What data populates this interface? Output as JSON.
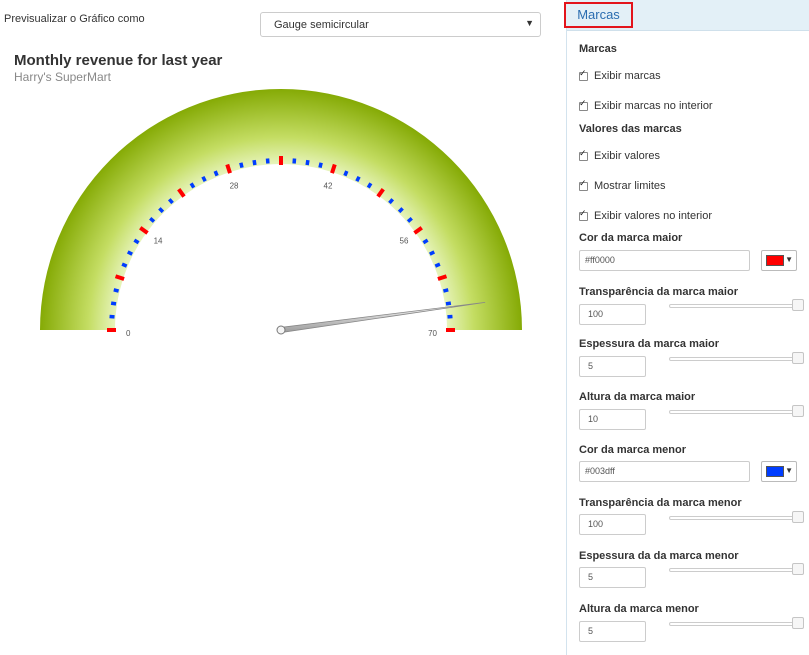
{
  "preview": {
    "label": "Previsualizar o Gráfico como",
    "chart_type": "Gauge semicircular"
  },
  "chart": {
    "title": "Monthly revenue for last year",
    "subtitle": "Harry's SuperMart"
  },
  "chart_data": {
    "type": "gauge",
    "min": 0,
    "max": 70,
    "value": 67,
    "major_tick_labels": [
      "0",
      "14",
      "28",
      "42",
      "56",
      "70"
    ],
    "major_ticks": [
      0,
      7,
      14,
      21,
      28,
      35,
      42,
      49,
      56,
      63,
      70
    ],
    "minor_ticks_between_major": 3,
    "colors": {
      "major_tick": "#ff0000",
      "minor_tick": "#003dff",
      "band_outer": "#88ad06",
      "band_inner": "#eef9cf"
    }
  },
  "panel": {
    "tab_label": "Marcas",
    "section_marcas": "Marcas",
    "show_ticks": "Exibir marcas",
    "show_ticks_inside": "Exibir marcas no interior",
    "section_values": "Valores das marcas",
    "show_values": "Exibir valores",
    "show_limits": "Mostrar limites",
    "show_values_inside": "Exibir valores no interior",
    "major_color_label": "Cor da marca maior",
    "major_color_value": "#ff0000",
    "major_color_swatch": "#ff0000",
    "major_alpha_label": "Transparência da marca maior",
    "major_alpha_value": "100",
    "major_thickness_label": "Espessura da marca maior",
    "major_thickness_value": "5",
    "major_height_label": "Altura da marca maior",
    "major_height_value": "10",
    "minor_color_label": "Cor da marca menor",
    "minor_color_value": "#003dff",
    "minor_color_swatch": "#003dff",
    "minor_alpha_label": "Transparência da marca menor",
    "minor_alpha_value": "100",
    "minor_thickness_label": "Espessura da da marca menor",
    "minor_thickness_value": "5",
    "minor_height_label": "Altura da marca menor",
    "minor_height_value": "5"
  }
}
